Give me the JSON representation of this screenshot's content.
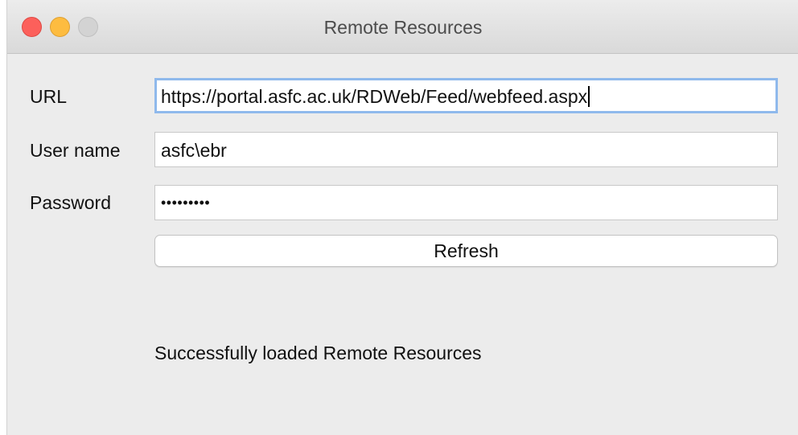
{
  "window": {
    "title": "Remote Resources"
  },
  "form": {
    "url_label": "URL",
    "url_value": "https://portal.asfc.ac.uk/RDWeb/Feed/webfeed.aspx",
    "username_label": "User name",
    "username_value": "asfc\\ebr",
    "password_label": "Password",
    "password_masked": "•••••••••",
    "refresh_label": "Refresh"
  },
  "status": {
    "message": "Successfully loaded Remote Resources"
  },
  "colors": {
    "close": "#fc605b",
    "minimize": "#fdbc40",
    "zoom_inactive": "#d3d3d3",
    "focus_ring": "#8fb9ec"
  }
}
